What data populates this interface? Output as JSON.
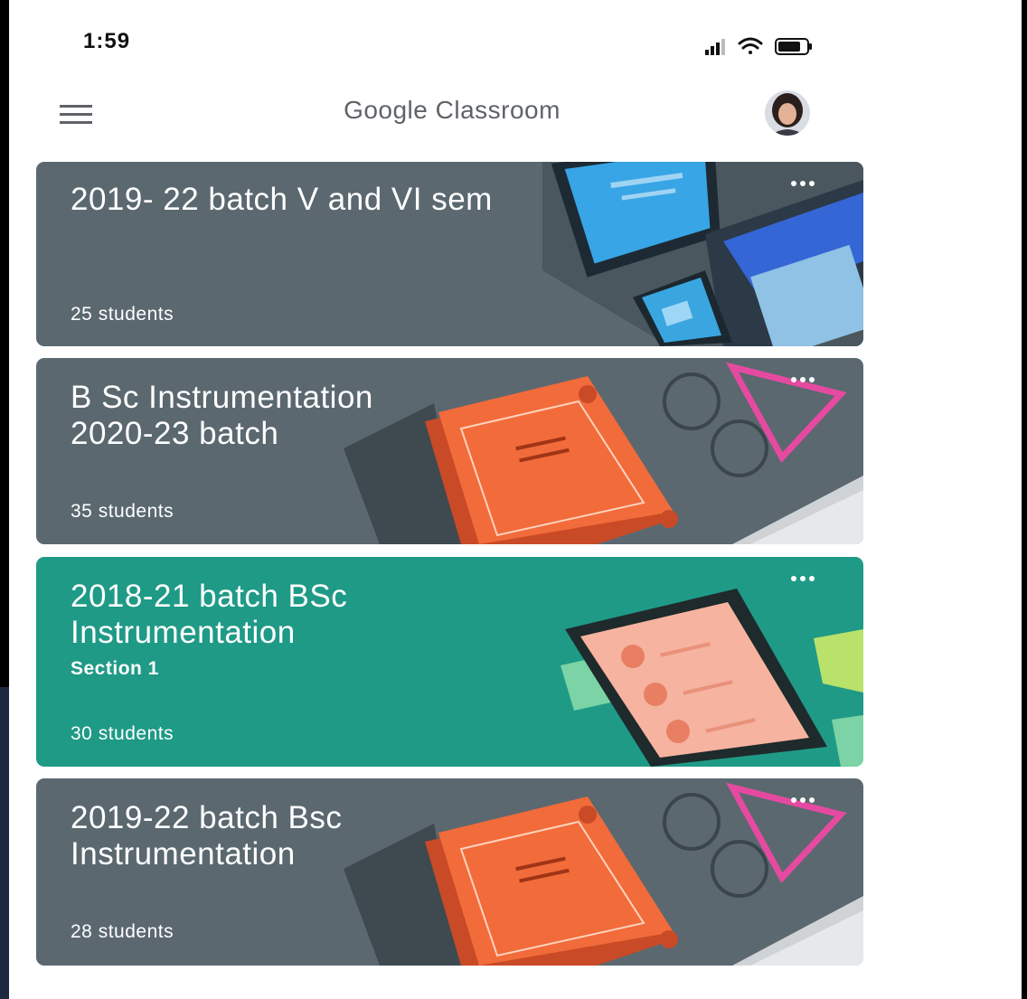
{
  "status_bar": {
    "time": "1:59",
    "icons": [
      "cellular-signal-icon",
      "wifi-icon",
      "battery-icon"
    ]
  },
  "header": {
    "title": "Google Classroom",
    "menu_icon": "hamburger-menu-icon",
    "avatar_icon": "profile-avatar"
  },
  "classes": [
    {
      "title_lines": [
        "2019- 22 batch V and VI sem"
      ],
      "section": "",
      "students": "25 students",
      "theme": "#5b6870",
      "art": "devices"
    },
    {
      "title_lines": [
        "B Sc Instrumentation",
        "2020-23 batch"
      ],
      "section": "",
      "students": "35 students",
      "theme": "#5b6870",
      "art": "book"
    },
    {
      "title_lines": [
        "2018-21 batch BSc",
        "Instrumentation"
      ],
      "section": "Section 1",
      "students": "30 students",
      "theme": "#1f9a86",
      "art": "phone"
    },
    {
      "title_lines": [
        "2019-22 batch Bsc",
        "Instrumentation"
      ],
      "section": "",
      "students": "28 students",
      "theme": "#5b6870",
      "art": "book"
    }
  ],
  "colors": {
    "card_gray": "#5b6870",
    "card_teal": "#1f9a86",
    "book_orange": "#f26b3a",
    "header_text": "#5f6368"
  }
}
